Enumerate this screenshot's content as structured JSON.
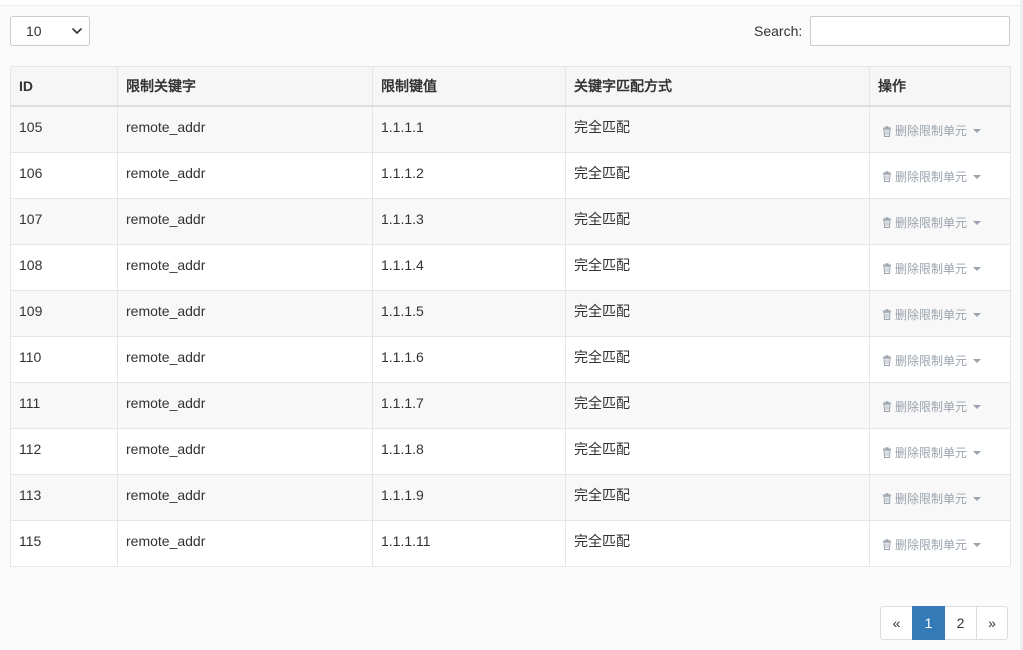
{
  "controls": {
    "length_value": "10",
    "search_label": "Search:",
    "search_value": "",
    "search_placeholder": ""
  },
  "table": {
    "columns": [
      "ID",
      "限制关键字",
      "限制键值",
      "关键字匹配方式",
      "操作"
    ],
    "rows": [
      {
        "id": "105",
        "key": "remote_addr",
        "value": "1.1.1.1",
        "match": "完全匹配",
        "action": "删除限制单元"
      },
      {
        "id": "106",
        "key": "remote_addr",
        "value": "1.1.1.2",
        "match": "完全匹配",
        "action": "删除限制单元"
      },
      {
        "id": "107",
        "key": "remote_addr",
        "value": "1.1.1.3",
        "match": "完全匹配",
        "action": "删除限制单元"
      },
      {
        "id": "108",
        "key": "remote_addr",
        "value": "1.1.1.4",
        "match": "完全匹配",
        "action": "删除限制单元"
      },
      {
        "id": "109",
        "key": "remote_addr",
        "value": "1.1.1.5",
        "match": "完全匹配",
        "action": "删除限制单元"
      },
      {
        "id": "110",
        "key": "remote_addr",
        "value": "1.1.1.6",
        "match": "完全匹配",
        "action": "删除限制单元"
      },
      {
        "id": "111",
        "key": "remote_addr",
        "value": "1.1.1.7",
        "match": "完全匹配",
        "action": "删除限制单元"
      },
      {
        "id": "112",
        "key": "remote_addr",
        "value": "1.1.1.8",
        "match": "完全匹配",
        "action": "删除限制单元"
      },
      {
        "id": "113",
        "key": "remote_addr",
        "value": "1.1.1.9",
        "match": "完全匹配",
        "action": "删除限制单元"
      },
      {
        "id": "115",
        "key": "remote_addr",
        "value": "1.1.1.11",
        "match": "完全匹配",
        "action": "删除限制单元"
      }
    ]
  },
  "pagination": {
    "prev_label": "«",
    "pages": [
      "1",
      "2"
    ],
    "active_page": "1",
    "next_label": "»"
  },
  "icons": {
    "select_arrow": "chevron-down-icon",
    "action_icon": "trash-icon",
    "action_caret": "caret-down-icon"
  },
  "colors": {
    "accent": "#337ab7",
    "action_text": "#9aa3ad",
    "row_stripe": "#f8f8f8",
    "header_bg": "#f6f6f6"
  }
}
